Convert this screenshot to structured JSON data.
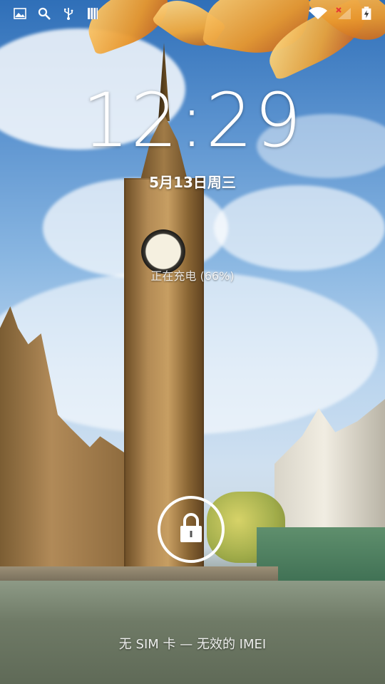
{
  "status_bar": {
    "left_icons": [
      "gallery-icon",
      "search-icon",
      "usb-icon",
      "sd-card-icon"
    ],
    "right_icons": [
      "wifi-icon",
      "no-signal-icon",
      "battery-charging-icon"
    ]
  },
  "lockscreen": {
    "time": "12:29",
    "date": "5月13日周三",
    "charging_status": "正在充电 (66%)",
    "battery_level_percent": 66,
    "carrier_status": "无 SIM 卡 — 无效的 IMEI",
    "unlock_icon": "lock-icon"
  },
  "colors": {
    "text": "#ffffff",
    "sky": "#5a92cf"
  }
}
